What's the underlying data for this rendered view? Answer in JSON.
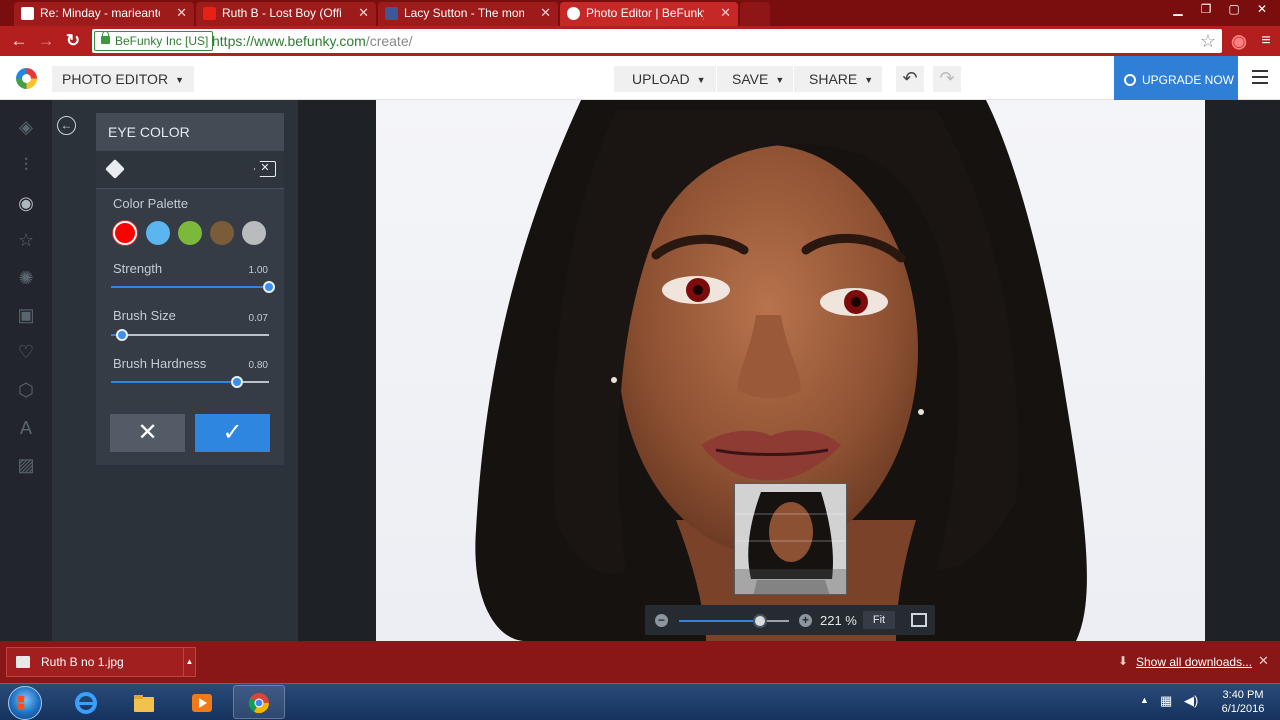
{
  "browser": {
    "tabs": [
      {
        "label": "Re: Minday - marieantoin",
        "icon": "gmail-icon",
        "color": "#ffffff"
      },
      {
        "label": "Ruth B - Lost Boy (Offic",
        "icon": "youtube-icon",
        "color": "#e62117"
      },
      {
        "label": "Lacy Sutton - The momen",
        "icon": "facebook-icon",
        "color": "#3b5998"
      },
      {
        "label": "Photo Editor | BeFunky: Fr",
        "icon": "befunky-icon",
        "color": "#ffffff"
      }
    ],
    "ev_badge": "BeFunky Inc [US]",
    "url_scheme_host": "https://www.befunky.com",
    "url_path": "/create/"
  },
  "app": {
    "mode_label": "PHOTO EDITOR",
    "upload_label": "UPLOAD",
    "save_label": "SAVE",
    "share_label": "SHARE",
    "upgrade_label": "UPGRADE NOW",
    "rail_icons": [
      "layers-icon",
      "sliders-icon",
      "eye-icon",
      "star-icon",
      "badge-icon",
      "frame-icon",
      "heart-icon",
      "shape-icon",
      "text-icon",
      "texture-icon"
    ],
    "active_rail_icon": "eye-icon"
  },
  "panel": {
    "title": "EYE COLOR",
    "palette_label": "Color Palette",
    "swatches": [
      "#ff0000",
      "#5bb6f0",
      "#7cb83a",
      "#7a5c3a",
      "#b8bcbf"
    ],
    "selected_swatch": 0,
    "strength": {
      "label": "Strength",
      "value": "1.00",
      "fraction": 1.0
    },
    "brush_size": {
      "label": "Brush Size",
      "value": "0.07",
      "fraction": 0.07
    },
    "brush_hardness": {
      "label": "Brush Hardness",
      "value": "0.80",
      "fraction": 0.8
    }
  },
  "zoom": {
    "value": "221 %",
    "fit_label": "Fit",
    "slider_fraction": 0.74
  },
  "downloads": {
    "file": "Ruth B no 1.jpg",
    "show_all": "Show all downloads..."
  },
  "taskbar": {
    "apps": [
      "ie-icon",
      "explorer-icon",
      "media-player-icon",
      "chrome-icon"
    ],
    "time": "3:40 PM",
    "date": "6/1/2016"
  }
}
